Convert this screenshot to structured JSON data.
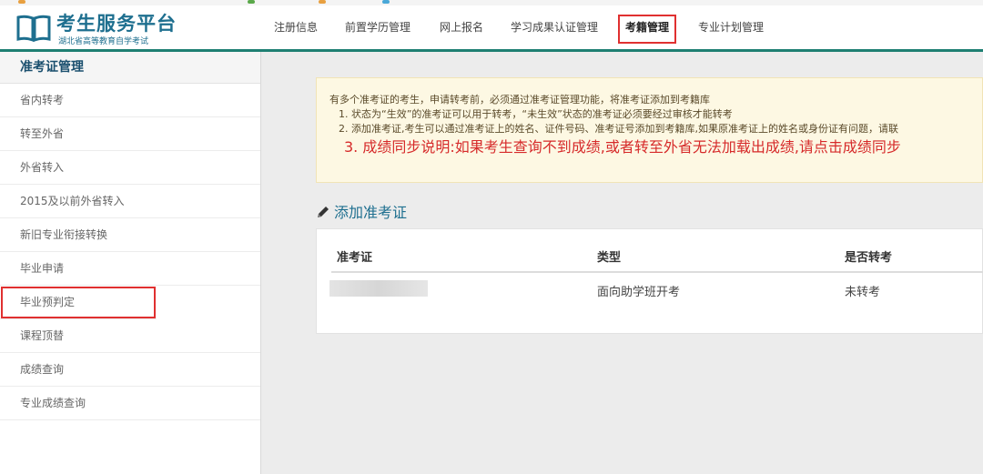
{
  "header": {
    "logo_title": "考生服务平台",
    "logo_subtitle": "湖北省高等教育自学考试"
  },
  "nav": {
    "items": [
      {
        "label": "注册信息"
      },
      {
        "label": "前置学历管理"
      },
      {
        "label": "网上报名"
      },
      {
        "label": "学习成果认证管理"
      },
      {
        "label": "考籍管理",
        "active": true
      },
      {
        "label": "专业计划管理"
      }
    ]
  },
  "sidebar": {
    "heading": "准考证管理",
    "items": [
      {
        "label": "省内转考"
      },
      {
        "label": "转至外省"
      },
      {
        "label": "外省转入"
      },
      {
        "label": "2015及以前外省转入"
      },
      {
        "label": "新旧专业衔接转换"
      },
      {
        "label": "毕业申请"
      },
      {
        "label": "毕业预判定",
        "highlighted": true
      },
      {
        "label": "课程顶替"
      },
      {
        "label": "成绩查询"
      },
      {
        "label": "专业成绩查询"
      }
    ]
  },
  "notice": {
    "intro": "有多个准考证的考生，申请转考前，必须通过准考证管理功能，将准考证添加到考籍库",
    "line1": "1. 状态为“生效”的准考证可以用于转考，“未生效”状态的准考证必须要经过审核才能转考",
    "line2": "2. 添加准考证,考生可以通过准考证上的姓名、证件号码、准考证号添加到考籍库,如果原准考证上的姓名或身份证有问题，请联",
    "line3": "3. 成绩同步说明:如果考生查询不到成绩,或者转至外省无法加载出成绩,请点击成绩同步"
  },
  "section": {
    "title": "添加准考证"
  },
  "table": {
    "headers": [
      "准考证",
      "类型",
      "是否转考"
    ],
    "rows": [
      {
        "type": "面向助学班开考",
        "transfer": "未转考"
      }
    ]
  },
  "colors": {
    "accent": "#1e7f72",
    "brand": "#1e6f8f",
    "highlight_border": "#e03030",
    "notice_red": "#d62a2a"
  }
}
